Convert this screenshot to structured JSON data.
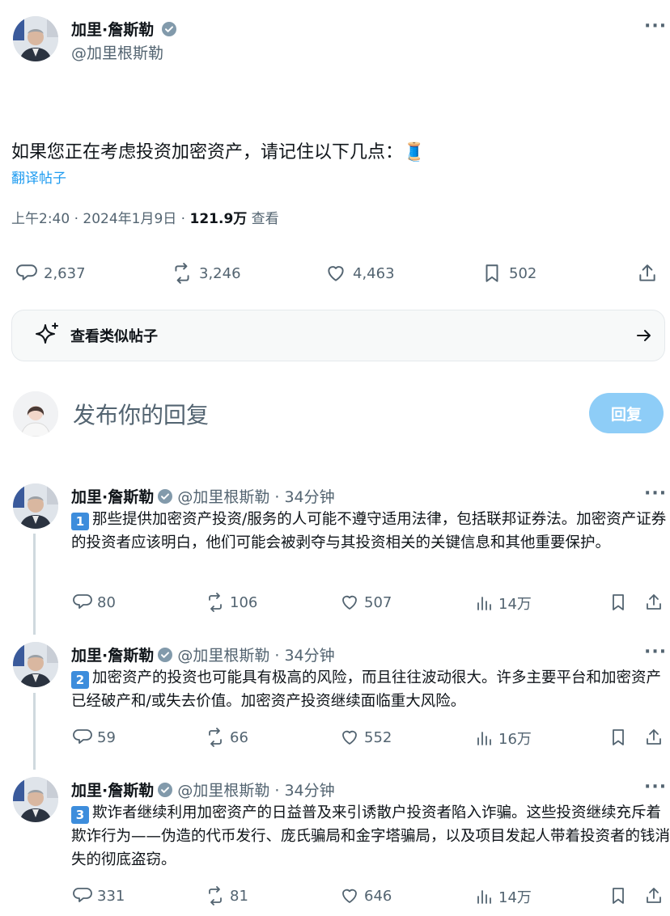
{
  "post": {
    "author_name": "加里·詹斯勒",
    "author_handle": "@加里根斯勒",
    "text": "如果您正在考虑投资加密资产，请记住以下几点：",
    "thread_emoji": "🧵",
    "translate_label": "翻译帖子",
    "time": "上午2:40 · 2024年1月9日 · ",
    "views": "121.9万",
    "views_label": " 查看",
    "replies": "2,637",
    "reposts": "3,246",
    "likes": "4,463",
    "bookmarks": "502"
  },
  "similar": {
    "label": "查看类似帖子"
  },
  "composer": {
    "placeholder": "发布你的回复",
    "reply_button": "回复"
  },
  "replies": [
    {
      "name": "加里·詹斯勒",
      "handle": "@加里根斯勒",
      "time": " · 34分钟",
      "badge": "1",
      "text": "那些提供加密资产投资/服务的人可能不遵守适用法律，包括联邦证券法。加密资产证券的投资者应该明白，他们可能会被剥夺与其投资相关的关键信息和其他重要保护。",
      "comments": "80",
      "reposts": "106",
      "likes": "507",
      "views": "14万"
    },
    {
      "name": "加里·詹斯勒",
      "handle": "@加里根斯勒",
      "time": " · 34分钟",
      "badge": "2",
      "text": "加密资产的投资也可能具有极高的风险，而且往往波动很大。许多主要平台和加密资产已经破产和/或失去价值。加密资产投资继续面临重大风险。",
      "comments": "59",
      "reposts": "66",
      "likes": "552",
      "views": "16万"
    },
    {
      "name": "加里·詹斯勒",
      "handle": "@加里根斯勒",
      "time": " · 34分钟",
      "badge": "3",
      "text": "欺诈者继续利用加密资产的日益普及来引诱散户投资者陷入诈骗。这些投资继续充斥着欺诈行为——伪造的代币发行、庞氏骗局和金字塔骗局，以及项目发起人带着投资者的钱消失的彻底盗窃。",
      "comments": "331",
      "reposts": "81",
      "likes": "646",
      "views": "14万"
    }
  ],
  "colors": {
    "accent": "#1d9bf0",
    "muted": "#536471",
    "reply_button": "#8ecdf7",
    "badge": "#3d8ddc"
  }
}
